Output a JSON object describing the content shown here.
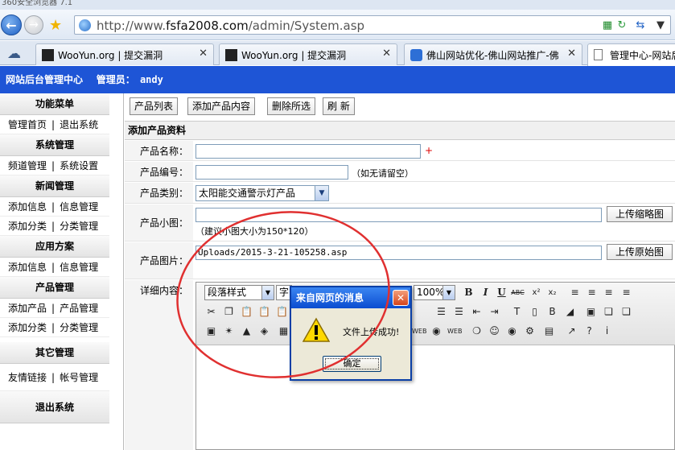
{
  "browser": {
    "title": "360安全浏览器 7.1",
    "address_prefix": "http://www.",
    "address_domain": "fsfa2008.com",
    "address_path": "/admin/System.asp",
    "tabs": [
      {
        "label": "WooYun.org | 提交漏洞",
        "icon": "wooyun-icon"
      },
      {
        "label": "WooYun.org | 提交漏洞",
        "icon": "wooyun-icon"
      },
      {
        "label": "佛山网站优化-佛山网站推广-佛",
        "icon": "site-icon"
      },
      {
        "label": "管理中心-网站后",
        "icon": "page-icon"
      }
    ]
  },
  "admin": {
    "site_title": "网站后台管理中心",
    "admin_label": "管理员：",
    "admin_name": "andy"
  },
  "sidebar": {
    "sections": [
      {
        "title": "功能菜单",
        "rows": [
          [
            "管理首页",
            "退出系统"
          ]
        ]
      },
      {
        "title": "系统管理",
        "rows": [
          [
            "频道管理",
            "系统设置"
          ]
        ]
      },
      {
        "title": "新闻管理",
        "rows": [
          [
            "添加信息",
            "信息管理"
          ],
          [
            "添加分类",
            "分类管理"
          ]
        ]
      },
      {
        "title": "应用方案",
        "rows": [
          [
            "添加信息",
            "信息管理"
          ]
        ]
      },
      {
        "title": "产品管理",
        "rows": [
          [
            "添加产品",
            "产品管理"
          ],
          [
            "添加分类",
            "分类管理"
          ]
        ]
      },
      {
        "title": "其它管理",
        "rows": [
          [
            "友情链接",
            "帐号管理"
          ]
        ]
      },
      {
        "title": "退出系统",
        "rows": []
      }
    ],
    "separator": "|"
  },
  "toolbar": {
    "product_list": "产品列表",
    "add_product": "添加产品内容",
    "delete_selected": "删除所选",
    "refresh": "刷 新"
  },
  "form": {
    "section_title": "添加产品资料",
    "name_label": "产品名称：",
    "name_value": "",
    "required_mark": "+",
    "code_label": "产品编号：",
    "code_value": "",
    "code_note": "（如无请留空）",
    "category_label": "产品类别：",
    "category_value": "太阳能交通警示灯产品",
    "thumb_label": "产品小图：",
    "thumb_value": "",
    "thumb_note": "（建议小图大小为150*120）",
    "thumb_upload": "上传缩略图",
    "image_label": "产品图片：",
    "image_value": "Uploads/2015-3-21-105258.asp",
    "image_upload": "上传原始图",
    "detail_label": "详细内容："
  },
  "editor": {
    "format_select": "段落样式",
    "font_select": "字",
    "zoom_select": "100%"
  },
  "dialog": {
    "title": "来自网页的消息",
    "message": "文件上传成功!",
    "ok": "确定"
  },
  "colors": {
    "header_blue": "#1e55d6",
    "dialog_title": "#0a4cd0",
    "annotation": "#e03030"
  }
}
